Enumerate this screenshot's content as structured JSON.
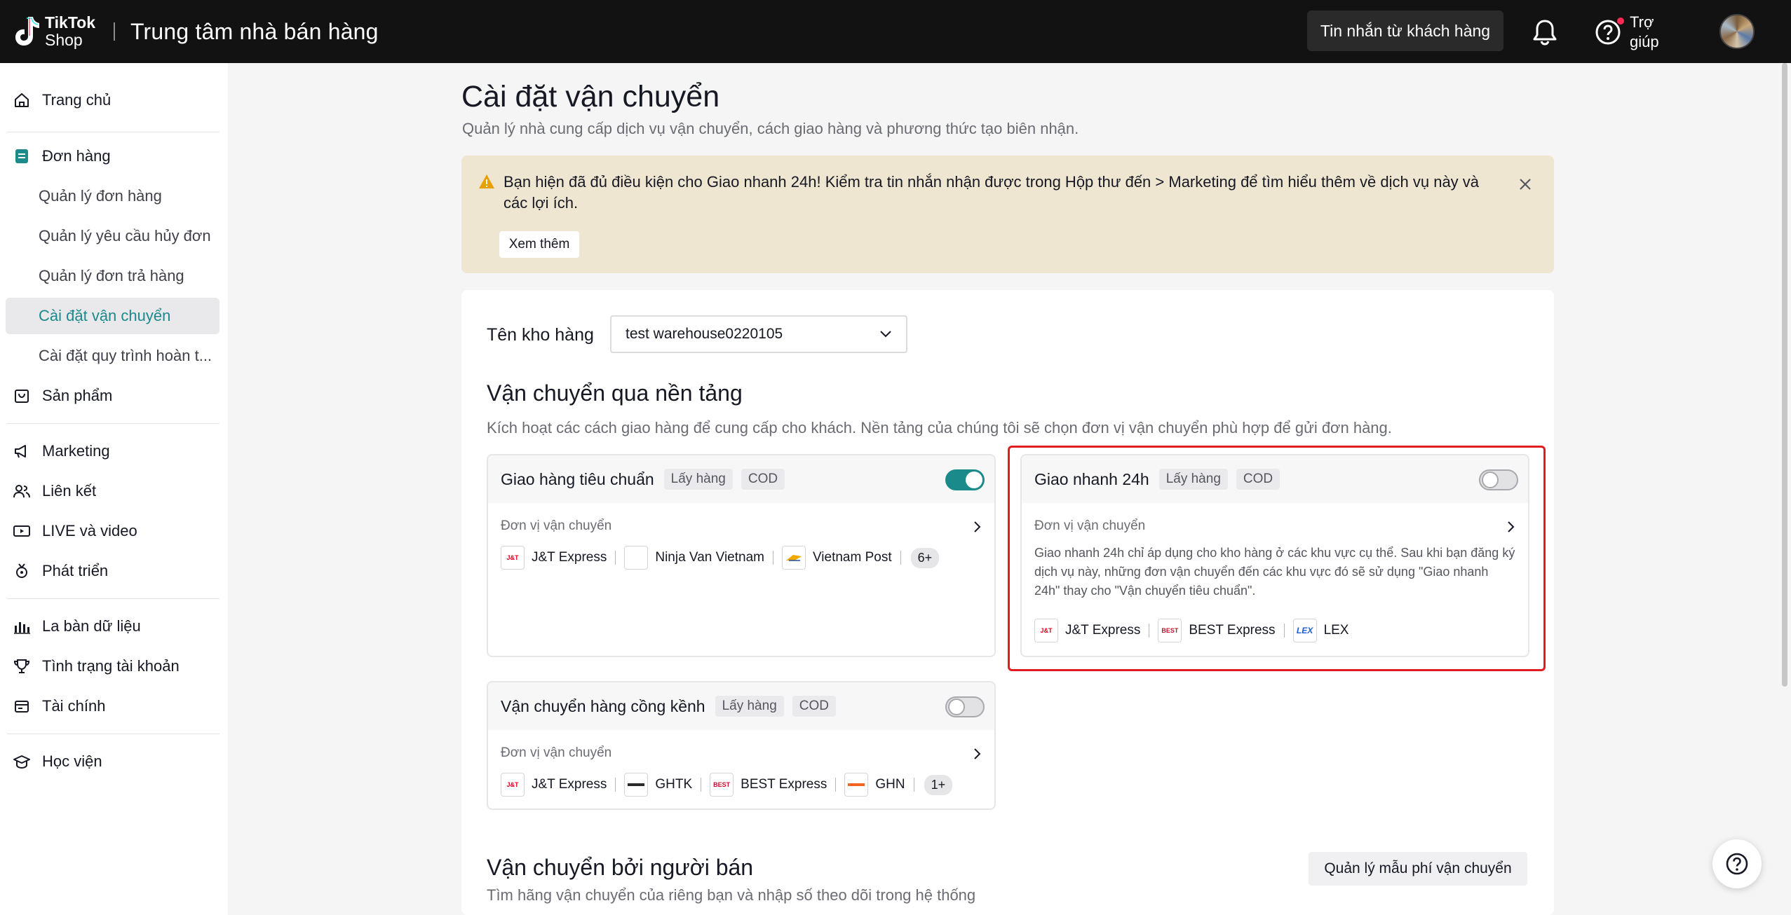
{
  "header": {
    "brand_line1": "TikTok",
    "brand_line2": "Shop",
    "app_title": "Trung tâm nhà bán hàng",
    "messages_button": "Tin nhắn từ khách hàng",
    "help_label": "Trợ giúp"
  },
  "sidebar": {
    "items": [
      {
        "label": "Trang chủ",
        "icon": "home-icon"
      },
      {
        "label": "Đơn hàng",
        "icon": "orders-icon"
      },
      {
        "label": "Quản lý đơn hàng"
      },
      {
        "label": "Quản lý yêu cầu hủy đơn"
      },
      {
        "label": "Quản lý đơn trả hàng"
      },
      {
        "label": "Cài đặt vận chuyển"
      },
      {
        "label": "Cài đặt quy trình hoàn t..."
      },
      {
        "label": "Sản phẩm",
        "icon": "product-icon"
      },
      {
        "label": "Marketing",
        "icon": "megaphone-icon"
      },
      {
        "label": "Liên kết",
        "icon": "people-icon"
      },
      {
        "label": "LIVE và video",
        "icon": "live-icon"
      },
      {
        "label": "Phát triển",
        "icon": "medal-icon"
      },
      {
        "label": "La bàn dữ liệu",
        "icon": "chart-icon"
      },
      {
        "label": "Tình trạng tài khoản",
        "icon": "trophy-icon"
      },
      {
        "label": "Tài chính",
        "icon": "wallet-icon"
      },
      {
        "label": "Học viện",
        "icon": "graduation-icon"
      }
    ],
    "active": "Cài đặt vận chuyển"
  },
  "page": {
    "title": "Cài đặt vận chuyển",
    "subtitle": "Quản lý nhà cung cấp dịch vụ vận chuyển, cách giao hàng và phương thức tạo biên nhận."
  },
  "alert": {
    "text": "Bạn hiện đã đủ điều kiện cho Giao nhanh 24h! Kiểm tra tin nhắn nhận được trong Hộp thư đến > Marketing để tìm hiểu thêm về dịch vụ này và các lợi ích.",
    "button": "Xem thêm"
  },
  "warehouse": {
    "label": "Tên kho hàng",
    "selected": "test warehouse0220105"
  },
  "platform_shipping": {
    "title": "Vận chuyển qua nền tảng",
    "description": "Kích hoạt các cách giao hàng để cung cấp cho khách. Nền tảng của chúng tôi sẽ chọn đơn vị vận chuyển phù hợp để gửi đơn hàng.",
    "carrier_label": "Đơn vị vận chuyển",
    "tag_pickup": "Lấy hàng",
    "tag_cod": "COD",
    "cards": {
      "standard": {
        "name": "Giao hàng tiêu chuẩn",
        "enabled": true,
        "carriers": [
          "J&T Express",
          "Ninja Van Vietnam",
          "Vietnam Post"
        ],
        "more": "6+"
      },
      "express": {
        "name": "Giao nhanh 24h",
        "enabled": false,
        "description": "Giao nhanh 24h chỉ áp dụng cho kho hàng ở các khu vực cụ thể. Sau khi bạn đăng ký dịch vụ này, những đơn vận chuyển đến các khu vực đó sẽ sử dụng \"Giao nhanh 24h\" thay cho \"Vận chuyển tiêu chuẩn\".",
        "carriers": [
          "J&T Express",
          "BEST Express",
          "LEX"
        ]
      },
      "bulky": {
        "name": "Vận chuyển hàng cồng kềnh",
        "enabled": false,
        "carriers": [
          "J&T Express",
          "GHTK",
          "BEST Express",
          "GHN"
        ],
        "more": "1+"
      }
    }
  },
  "seller_shipping": {
    "title": "Vận chuyển bởi người bán",
    "description": "Tìm hãng vận chuyển của riêng bạn và nhập số theo dõi trong hệ thống",
    "fee_button": "Quản lý mẫu phí vận chuyển"
  },
  "colors": {
    "accent": "#1b8a8a",
    "alert_bg": "#efe6d1",
    "highlight": "#e11d22",
    "topbar": "#121212"
  }
}
